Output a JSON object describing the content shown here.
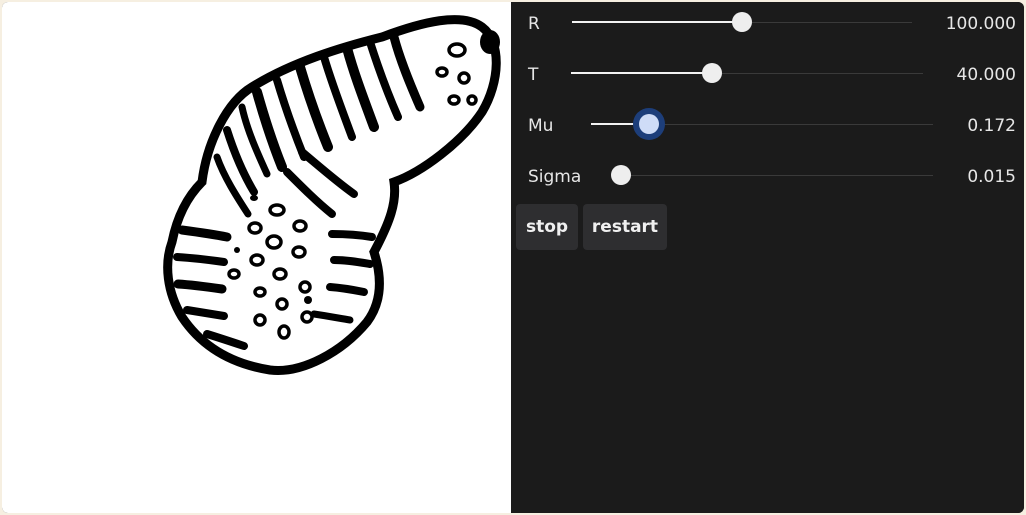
{
  "sliders": [
    {
      "label": "R",
      "value": "100.000",
      "fraction": 0.5
    },
    {
      "label": "T",
      "value": "40.000",
      "fraction": 0.4
    },
    {
      "label": "Mu",
      "value": "0.172",
      "fraction": 0.17
    },
    {
      "label": "Sigma",
      "value": "0.015",
      "fraction": 0.0
    }
  ],
  "buttons": {
    "stop_label": "stop",
    "restart_label": "restart"
  },
  "colors": {
    "panel_bg": "#1b1b1b",
    "canvas_bg": "#ffffff",
    "active_thumb": "#cfdcf7",
    "button_bg": "#2e2e30"
  }
}
